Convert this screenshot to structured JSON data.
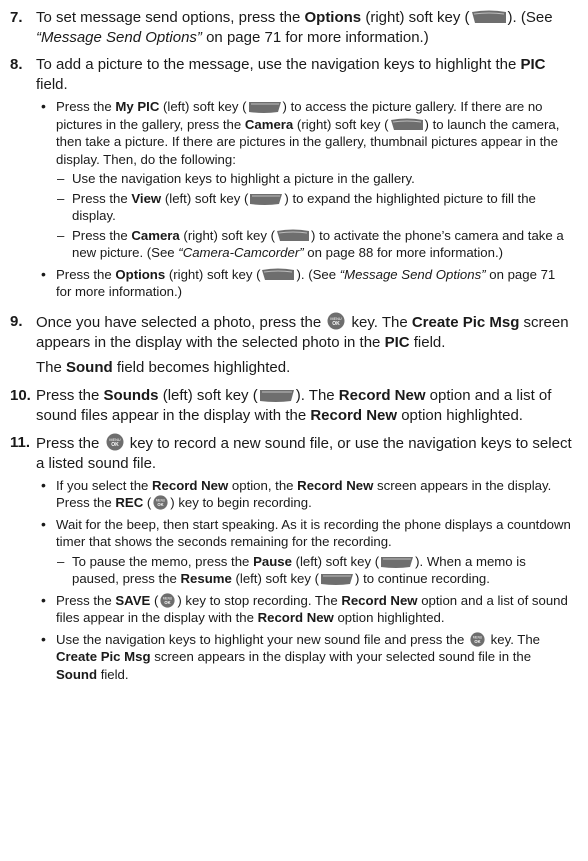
{
  "icons": {
    "left_softkey": "left-soft-key-icon",
    "right_softkey": "right-soft-key-icon",
    "ok_key": "menu-ok-key-icon",
    "ok_label_top": "MENU",
    "ok_label_bottom": "OK"
  },
  "step7": {
    "num": "7.",
    "t1": "To set message send options, press the ",
    "b1": "Options",
    "t2": " (right) soft key (",
    "t3": "). (See ",
    "i1": "“Message Send Options”",
    "t4": " on page 71 for more information.)"
  },
  "step8": {
    "num": "8.",
    "t1": "To add a picture to the message, use the navigation keys to highlight the ",
    "b1": "PIC",
    "t2": " field.",
    "bullet1": {
      "t1": "Press the ",
      "b1": "My PIC",
      "t2": " (left) soft key (",
      "t3": ") to access the picture gallery. If there are no pictures in the gallery, press the ",
      "b2": "Camera",
      "t4": " (right) soft key (",
      "t5": ") to launch the camera, then take a picture. If there are pictures in the gallery, thumbnail pictures appear in the display. Then, do the following:"
    },
    "dash1": "Use the navigation keys to highlight a picture in the gallery.",
    "dash2": {
      "t1": "Press the ",
      "b1": "View",
      "t2": " (left) soft key (",
      "t3": ") to expand the highlighted picture to fill the display."
    },
    "dash3": {
      "t1": "Press the ",
      "b1": "Camera",
      "t2": " (right) soft key (",
      "t3": ") to activate the phone’s camera and take a new picture. (See ",
      "i1": "“Camera-Camcorder”",
      "t4": " on page 88 for more information.)"
    },
    "bullet2": {
      "t1": "Press the ",
      "b1": "Options",
      "t2": " (right) soft key (",
      "t3": "). (See ",
      "i1": "“Message Send Options”",
      "t4": " on page 71 for more information.)"
    }
  },
  "step9": {
    "num": "9.",
    "t1": "Once you have selected a photo, press the ",
    "t2": " key. The ",
    "b1": "Create Pic Msg",
    "t3": " screen appears in the display with the selected photo in the ",
    "b2": "PIC",
    "t4": " field.",
    "after_t1": "The ",
    "after_b1": "Sound",
    "after_t2": " field becomes highlighted."
  },
  "step10": {
    "num": "10.",
    "t1": "Press the ",
    "b1": "Sounds",
    "t2": " (left) soft key (",
    "t3": "). The ",
    "b2": "Record New",
    "t4": " option and a list of sound files appear in the display with the ",
    "b3": "Record New",
    "t5": " option highlighted."
  },
  "step11": {
    "num": "11.",
    "t1": "Press the ",
    "t2": " key to record a new sound file, or use the navigation keys to select a listed sound file.",
    "bullet1": {
      "t1": "If you select the ",
      "b1": "Record New",
      "t2": " option, the ",
      "b2": "Record New",
      "t3": " screen appears in the display. Press the ",
      "b3": "REC",
      "t4": " (",
      "t5": ") key to begin recording."
    },
    "bullet2": "Wait for the beep, then start speaking. As it is recording the phone displays a countdown timer that shows the seconds remaining for the recording.",
    "dash1": {
      "t1": "To pause the memo, press the ",
      "b1": "Pause",
      "t2": " (left) soft key (",
      "t3": "). When a memo is paused, press the ",
      "b2": "Resume",
      "t4": " (left) soft key (",
      "t5": ") to continue recording."
    },
    "bullet3": {
      "t1": "Press the ",
      "b1": "SAVE",
      "t2": " (",
      "t3": ") key to stop recording. The ",
      "b2": "Record New",
      "t4": " option and a list of sound files appear in the display with the ",
      "b3": "Record New",
      "t5": " option highlighted."
    },
    "bullet4": {
      "t1": "Use the navigation keys to highlight your new sound file and press the ",
      "t2": " key. The ",
      "b1": "Create Pic Msg",
      "t3": " screen appears in the display with your selected sound file in the ",
      "b2": "Sound",
      "t4": " field."
    }
  }
}
